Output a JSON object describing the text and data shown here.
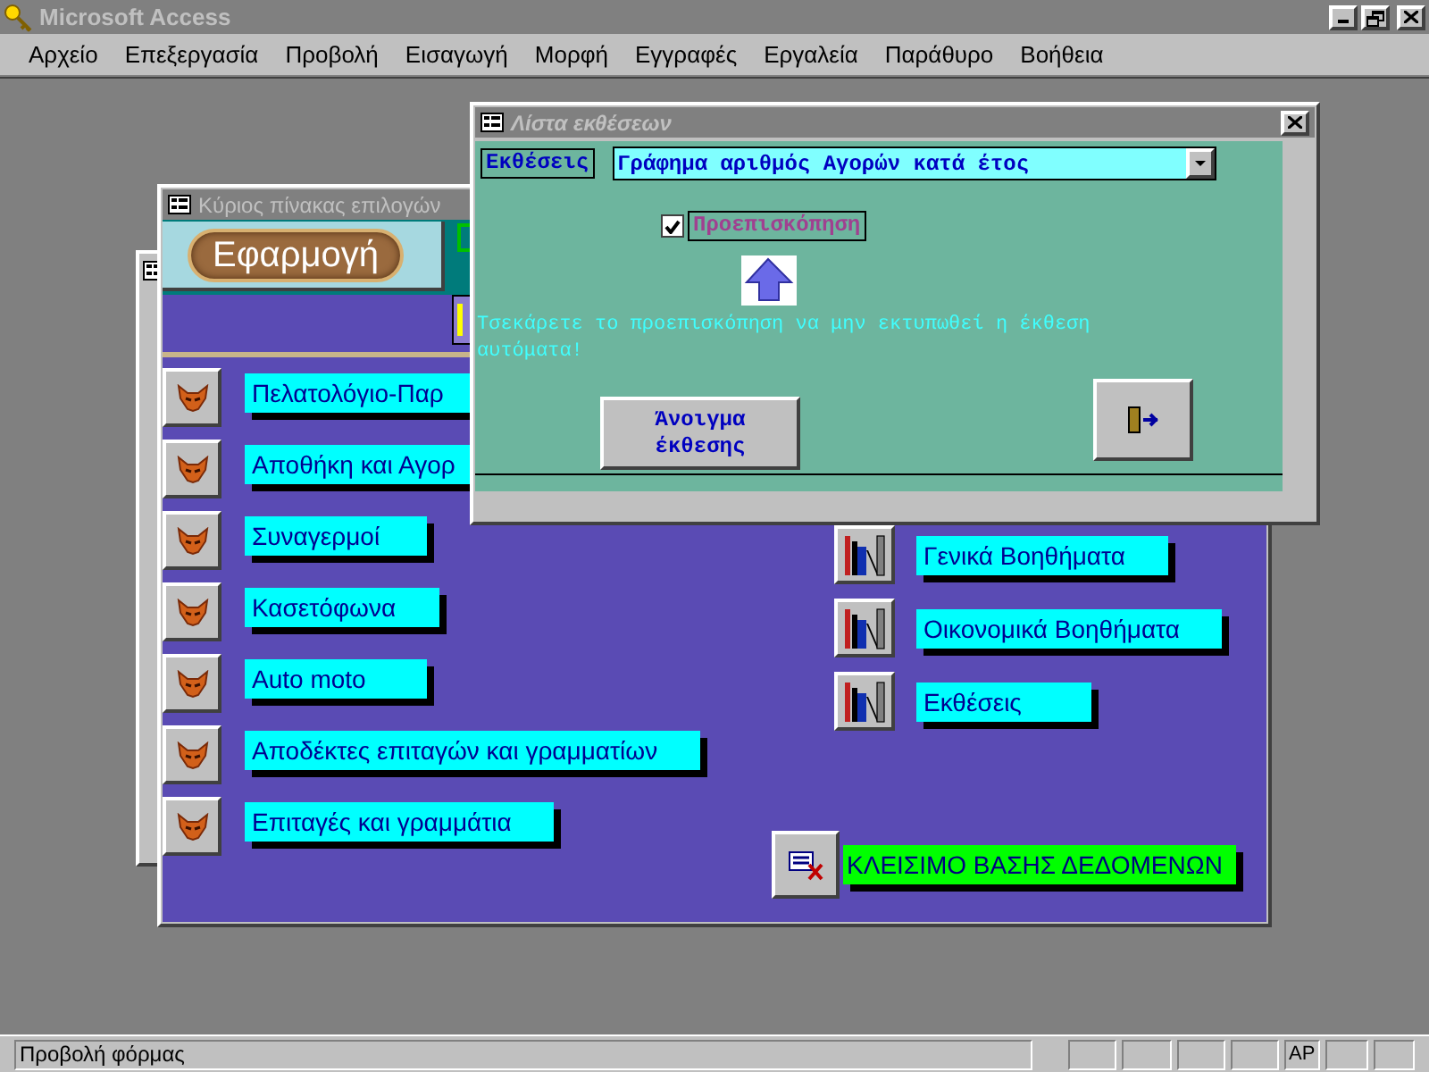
{
  "app_title": "Microsoft Access",
  "menu": [
    "Αρχείο",
    "Επεξεργασία",
    "Προβολή",
    "Εισαγωγή",
    "Μορφή",
    "Εγγραφές",
    "Εργαλεία",
    "Παράθυρο",
    "Βοήθεια"
  ],
  "switchboard": {
    "title": "Κύριος πίνακας επιλογών",
    "header_button": "Εφαρμογή",
    "left_items": [
      {
        "label": "Πελατολόγιο-Παρ"
      },
      {
        "label": "Αποθήκη και Αγορ"
      },
      {
        "label": "Συναγερμοί"
      },
      {
        "label": "Κασετόφωνα"
      },
      {
        "label": "Auto moto"
      },
      {
        "label": "Αποδέκτες επιταγών και γραμματίων"
      },
      {
        "label": "Επιταγές και γραμμάτια"
      }
    ],
    "right_items": [
      {
        "label": "Γενικά Βοηθήματα"
      },
      {
        "label": "Οικονομικά Βοηθήματα"
      },
      {
        "label": "Εκθέσεις"
      }
    ],
    "close_button": "ΚΛΕΙΣΙΜΟ ΒΑΣΗΣ ΔΕΔΟΜΕΝΩΝ"
  },
  "dialog": {
    "title": "Λίστα εκθέσεων",
    "reports_label": "Εκθέσεις",
    "reports_value": "Γράφημα αριθμός Αγορών κατά έτος",
    "preview": {
      "label": "Προεπισκόπηση",
      "checked": true
    },
    "hint": "Τσεκάρετε το προεπισκόπηση να μην εκτυπωθεί η έκθεση αυτόματα!",
    "open_button": "Άνοιγμα έκθεσης"
  },
  "status_bar": {
    "text": "Προβολή φόρμας",
    "indicator": "AP"
  }
}
